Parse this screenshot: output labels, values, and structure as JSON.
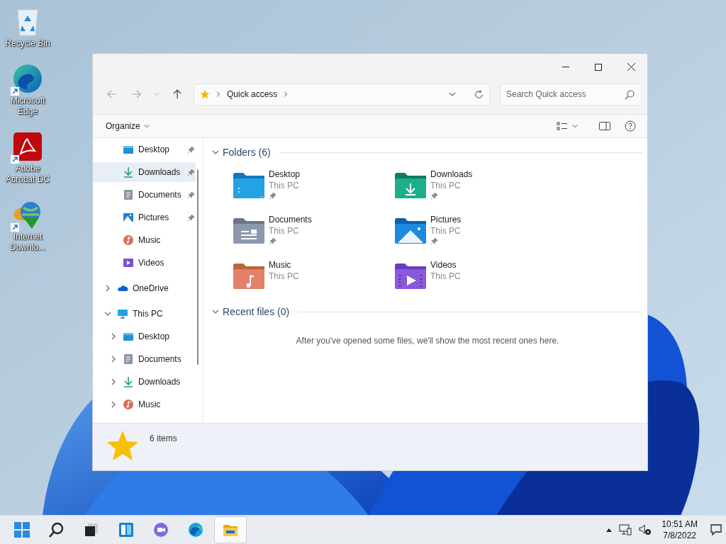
{
  "desktop_icons": [
    {
      "label": "Recycle Bin",
      "kind": "recycle",
      "shortcut": false
    },
    {
      "label": "Microsoft Edge",
      "kind": "edge",
      "shortcut": true
    },
    {
      "label": "Adobe Acrobat DC",
      "kind": "acrobat",
      "shortcut": true
    },
    {
      "label": "Internet Downlo...",
      "kind": "idm",
      "shortcut": true
    }
  ],
  "window": {
    "breadcrumb": [
      "Quick access"
    ],
    "search": {
      "placeholder": "Search Quick access"
    },
    "command_bar": {
      "organize": "Organize"
    }
  },
  "sidebar": {
    "items": [
      {
        "label": "Desktop",
        "kind": "desktop",
        "pinned": true,
        "selected": false
      },
      {
        "label": "Downloads",
        "kind": "downloads",
        "pinned": true,
        "selected": true
      },
      {
        "label": "Documents",
        "kind": "documents",
        "pinned": true,
        "selected": false
      },
      {
        "label": "Pictures",
        "kind": "pictures",
        "pinned": true,
        "selected": false
      },
      {
        "label": "Music",
        "kind": "music",
        "pinned": false,
        "selected": false
      },
      {
        "label": "Videos",
        "kind": "videos",
        "pinned": false,
        "selected": false
      },
      {
        "label": "OneDrive",
        "kind": "onedrive",
        "expanded": false,
        "selected": false
      },
      {
        "label": "This PC",
        "kind": "pc",
        "expanded": true,
        "selected": false,
        "children": [
          {
            "label": "Desktop",
            "kind": "desktop",
            "expanded": false,
            "selected": false
          },
          {
            "label": "Documents",
            "kind": "documents",
            "expanded": false,
            "selected": false
          },
          {
            "label": "Downloads",
            "kind": "downloads",
            "expanded": false,
            "selected": false
          },
          {
            "label": "Music",
            "kind": "music",
            "expanded": false,
            "selected": false
          }
        ]
      }
    ]
  },
  "folders_section": {
    "title": "Folders (6)",
    "expanded": true,
    "folders": [
      {
        "name": "Desktop",
        "location": "This PC",
        "kind": "desktop",
        "pinned": true
      },
      {
        "name": "Downloads",
        "location": "This PC",
        "kind": "downloads",
        "pinned": true
      },
      {
        "name": "Documents",
        "location": "This PC",
        "kind": "documents",
        "pinned": true
      },
      {
        "name": "Pictures",
        "location": "This PC",
        "kind": "pictures",
        "pinned": true
      },
      {
        "name": "Music",
        "location": "This PC",
        "kind": "music",
        "pinned": false
      },
      {
        "name": "Videos",
        "location": "This PC",
        "kind": "videos",
        "pinned": false
      }
    ]
  },
  "recent_section": {
    "title": "Recent files (0)",
    "expanded": true,
    "message": "After you've opened some files, we'll show the most recent ones here."
  },
  "status_bar": {
    "item_count": "6 items"
  },
  "taskbar": {
    "apps": [
      {
        "kind": "start",
        "selected": false
      },
      {
        "kind": "search",
        "selected": false
      },
      {
        "kind": "taskview",
        "selected": false
      },
      {
        "kind": "widgets",
        "selected": false
      },
      {
        "kind": "chat",
        "selected": false
      },
      {
        "kind": "edge",
        "selected": false
      },
      {
        "kind": "explorer",
        "selected": true
      }
    ],
    "clock": {
      "time": "10:51 AM",
      "date": "7/8/2022"
    }
  }
}
